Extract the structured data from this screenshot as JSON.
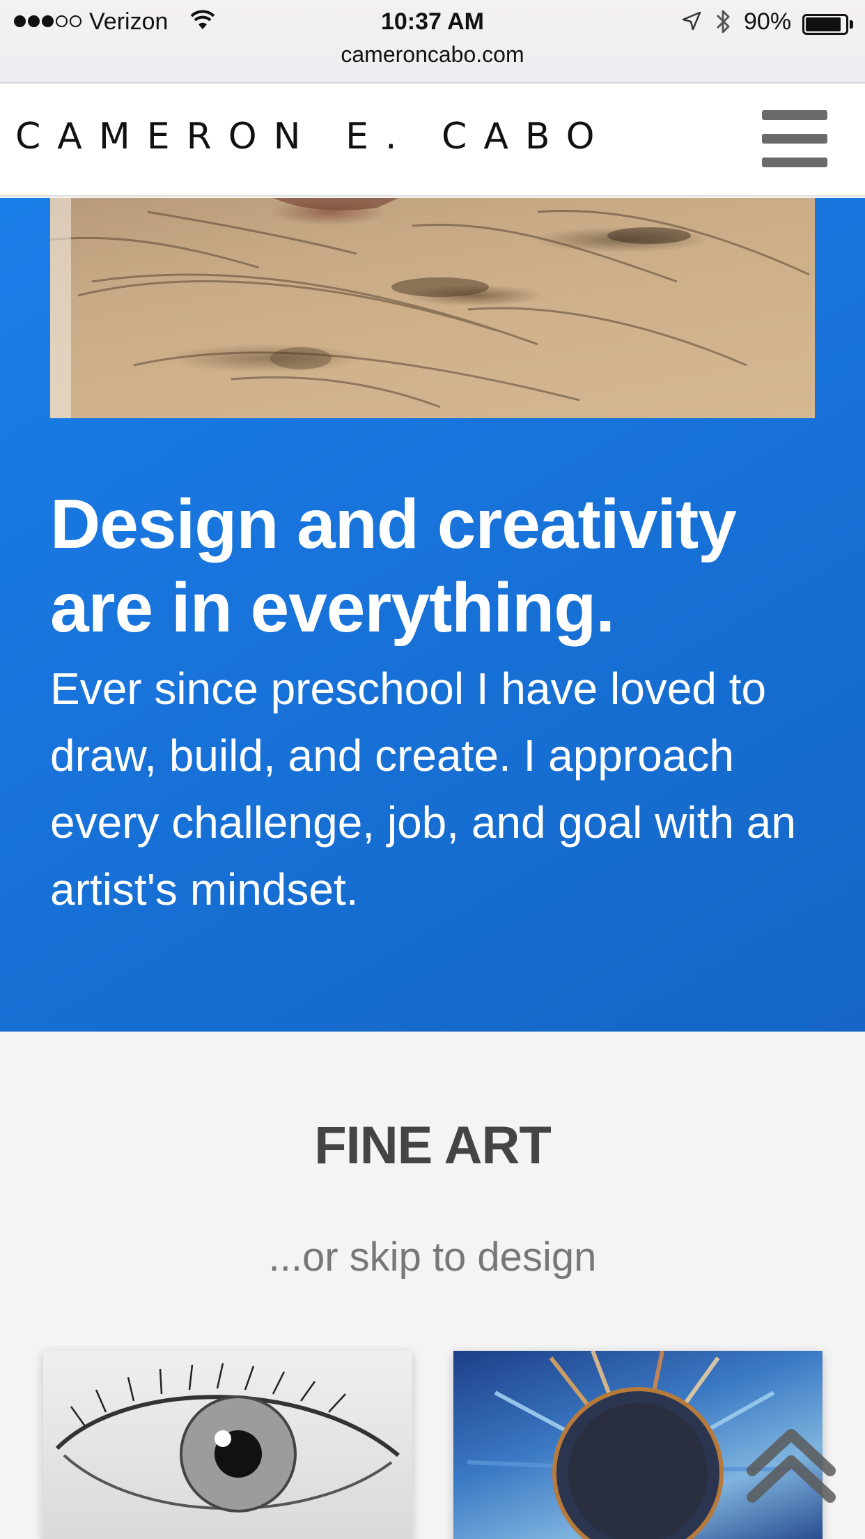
{
  "status_bar": {
    "carrier": "Verizon",
    "time": "10:37 AM",
    "battery": "90%",
    "battery_level": 0.9,
    "signal_bars": 3,
    "signal_total": 5,
    "url": "cameroncabo.com"
  },
  "header": {
    "site_title": "CAMERON E. CABO",
    "menu_icon": "hamburger-menu-icon"
  },
  "hero": {
    "image": "charcoal-drawing-on-cardboard-photo",
    "heading": "Design and creativity are in everything.",
    "body": "Ever since preschool I have loved to draw, build, and create. I approach every challenge, job, and goal with an artist's mindset.",
    "background_color": "#1a7ee8"
  },
  "fine_art": {
    "title": "FINE ART",
    "skip_link": "...or skip to design",
    "cards": [
      {
        "image": "pencil-eye-drawing"
      },
      {
        "image": "painted-blue-eye"
      }
    ]
  },
  "scroll_top_icon": "double-chevron-up-icon"
}
